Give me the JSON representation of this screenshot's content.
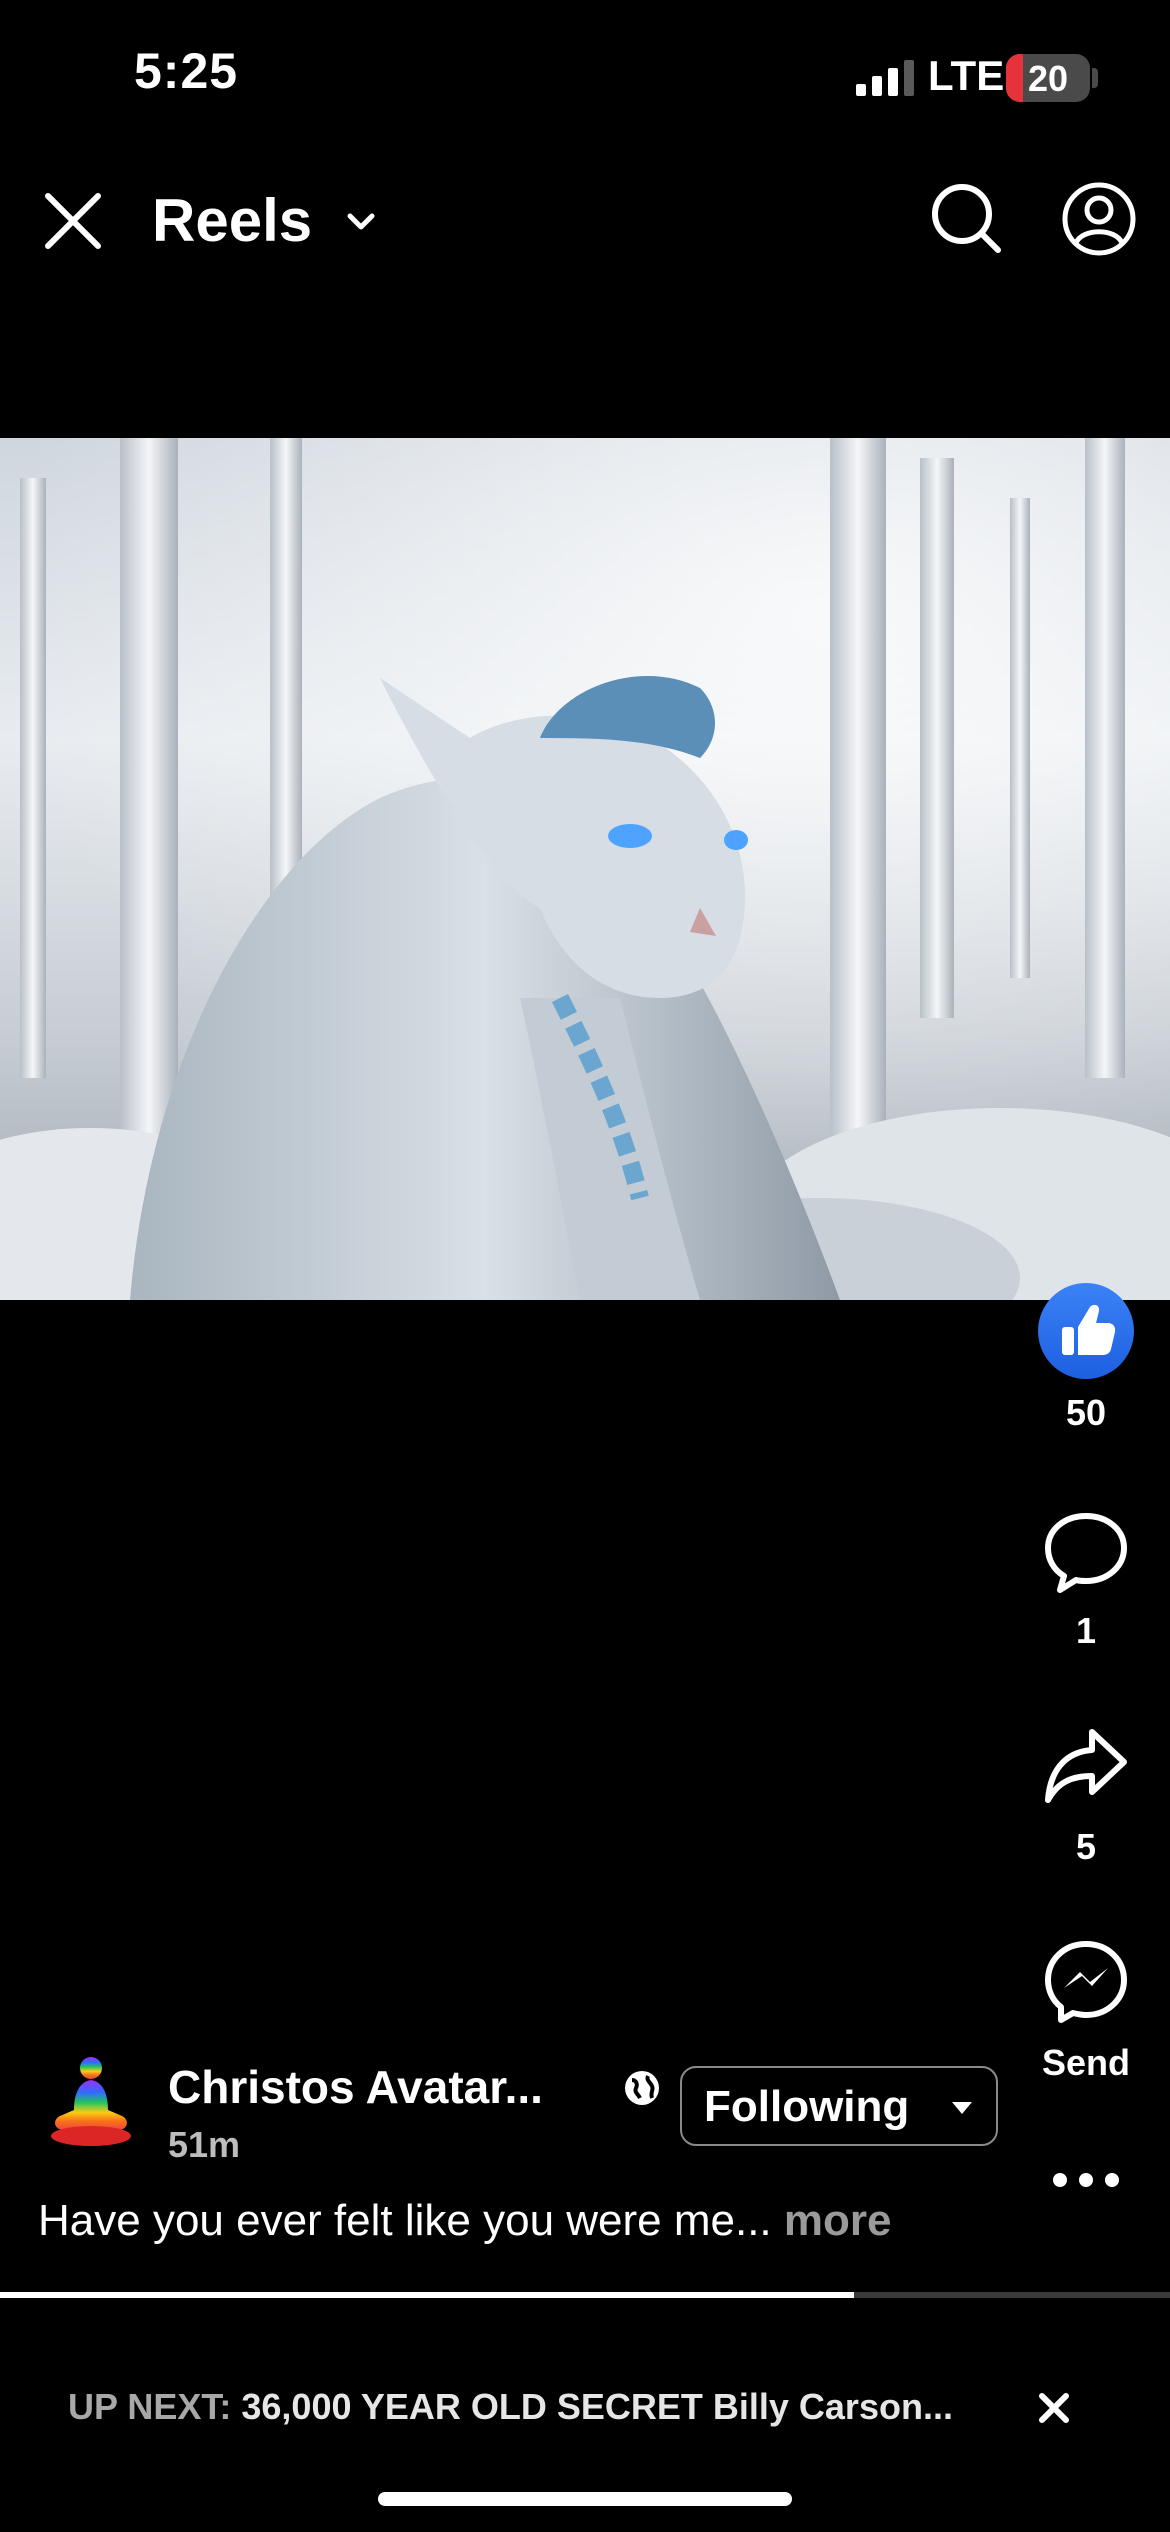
{
  "status_bar": {
    "time": "5:25",
    "network": "LTE",
    "battery": "20",
    "battery_level": 0.2,
    "battery_color": "#e5323b"
  },
  "header": {
    "title": "Reels",
    "icons": [
      "close-icon",
      "chevron-down-icon",
      "search-icon",
      "profile-icon"
    ]
  },
  "video": {
    "description": ""
  },
  "actions": {
    "like_count": "50",
    "comment_count": "1",
    "share_count": "5",
    "send_label": "Send",
    "like_color": "#2f73f0"
  },
  "post": {
    "author": "Christos Avatar...",
    "time_ago": "51m",
    "follow_label": "Following",
    "caption": "Have you ever felt like you were me...",
    "more_label": "more"
  },
  "playback": {
    "progress": 0.73
  },
  "up_next": {
    "label": "UP NEXT:",
    "title": "36,000 YEAR OLD SECRET Billy Carson..."
  }
}
